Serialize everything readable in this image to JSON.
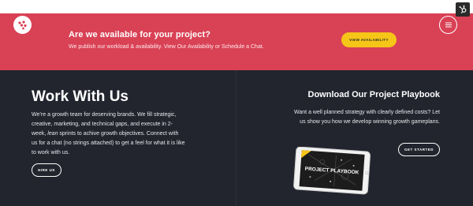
{
  "banner": {
    "title": "Are we available for your project?",
    "subtitle": "We publish our workload & availability. View Our Availability or Schedule a Chat.",
    "cta_label": "VIEW AVAILABILITY"
  },
  "left": {
    "title": "Work With Us",
    "body_part1": "We’re a growth team for deserving brands. We fill strategic, creative, marketing, and technical gaps, and execute in 2-week, ",
    "body_em": "lean",
    "body_part2": " sprints to achive growth objectives. Connect with us for a chat (no strings attached) to get a feel for what it is like to work with us.",
    "cta_label": "HIRE US"
  },
  "right": {
    "title": "Download Our Project Playbook",
    "body": "Want a well planned strategy with clearly defined costs? Let us show you how we develop winning growth gameplans.",
    "cta_label": "GET STARTED",
    "tablet_text": "PROJECT PLAYBOOK"
  },
  "colors": {
    "banner_bg": "#d94155",
    "dark_bg": "#22242e",
    "accent_yellow": "#f5c518"
  },
  "icons": [
    "hubspot-sprocket-icon",
    "brand-logo-icon",
    "hamburger-menu-icon"
  ]
}
